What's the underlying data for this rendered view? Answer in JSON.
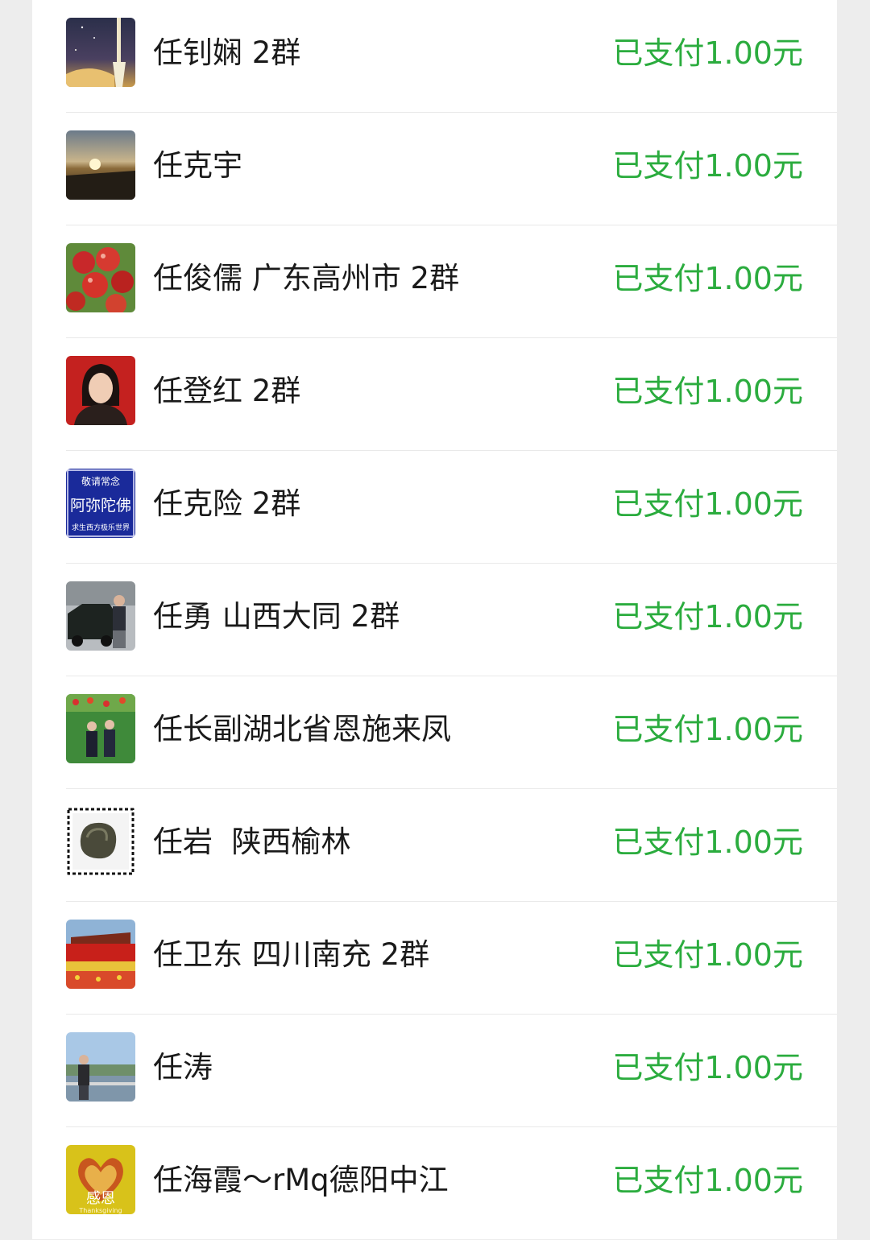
{
  "theme": {
    "page_bg": "#ededed",
    "panel_bg": "#ffffff",
    "status_color": "#2bac3e"
  },
  "members": [
    {
      "name": "任钊娴 2群",
      "status": "已支付1.00元",
      "avatar": "night-sky-tassel-avatar"
    },
    {
      "name": "任克宇",
      "status": "已支付1.00元",
      "avatar": "sunrise-clouds-avatar"
    },
    {
      "name": "任俊儒 广东高州市 2群",
      "status": "已支付1.00元",
      "avatar": "red-apples-avatar"
    },
    {
      "name": "任登红 2群",
      "status": "已支付1.00元",
      "avatar": "woman-portrait-avatar"
    },
    {
      "name": "任克险 2群",
      "status": "已支付1.00元",
      "avatar": "buddhist-text-avatar",
      "avatar_text": {
        "top": "敬请常念",
        "main": "阿弥陀佛",
        "bottom": "求生西方极乐世界"
      }
    },
    {
      "name": "任勇 山西大同 2群",
      "status": "已支付1.00元",
      "avatar": "man-with-car-avatar"
    },
    {
      "name": "任长副湖北省恩施来凤",
      "status": "已支付1.00元",
      "avatar": "couple-flower-garden-avatar"
    },
    {
      "name": "任岩  陕西榆林",
      "status": "已支付1.00元",
      "avatar": "stamp-stone-avatar"
    },
    {
      "name": "任卫东 四川南充 2群",
      "status": "已支付1.00元",
      "avatar": "tiananmen-flowers-avatar"
    },
    {
      "name": "任涛",
      "status": "已支付1.00元",
      "avatar": "man-by-river-avatar"
    },
    {
      "name": "任海霞～rMq德阳中江",
      "status": "已支付1.00元",
      "avatar": "heart-hands-avatar",
      "avatar_text": {
        "main": "感恩",
        "sub": "Thanksgiving"
      }
    }
  ]
}
